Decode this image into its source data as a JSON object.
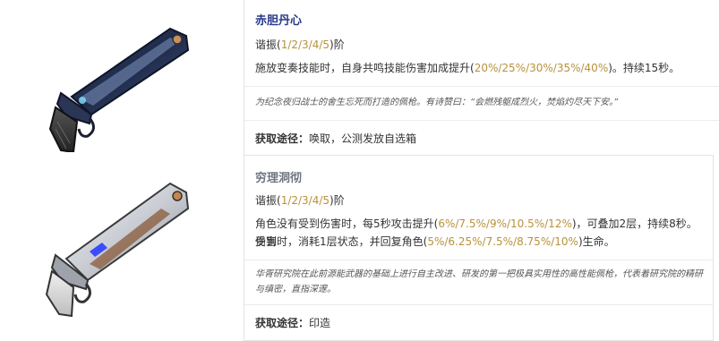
{
  "weapons": [
    {
      "name": "赤胆丹心",
      "resonance_prefix": "谐振(",
      "resonance_levels": "1/2/3/4/5",
      "resonance_suffix": ")阶",
      "effect_a": "施放变奏技能时，自身共鸣技能伤害加成提升(",
      "effect_a_values": "20%/25%/30%/35%/40%",
      "effect_a_end": ")。持续15秒。",
      "lore": "为纪念夜归战士的舍生忘死而打造的佩枪。有诗赞曰：“会燃残躯成烈火，焚焰灼尽天下安。”",
      "source_label": "获取途径：",
      "source_value": "唤取，公测发放自选箱",
      "icon": "blue-silver-pistol"
    },
    {
      "name": "穷理洞彻",
      "resonance_prefix": "谐振(",
      "resonance_levels": "1/2/3/4/5",
      "resonance_suffix": ")阶",
      "effect_a": "角色没有受到伤害时，每5秒攻击提升(",
      "effect_a_values": "6%/7.5%/9%/10.5%/12%",
      "effect_a_end": ")，可叠加2层，持续8秒。受到",
      "effect_b": "伤害时，消耗1层状态，并回复角色(",
      "effect_b_values": "5%/6.25%/7.5%/8.75%/10%",
      "effect_b_end": ")生命。",
      "lore_line1": "华胥研究院在此前源能武器的基础上进行自主改进、研发的第一把极具实用性的高性能佩枪，代表着研究院的精研",
      "lore_line2": "与缜密，直指深邃。",
      "source_label": "获取途径：",
      "source_value": "印造",
      "icon": "white-silver-pistol"
    }
  ],
  "colors": {
    "title_1": "#2a3a8a",
    "title_2": "#6e7680",
    "highlight": "#b8923a"
  }
}
